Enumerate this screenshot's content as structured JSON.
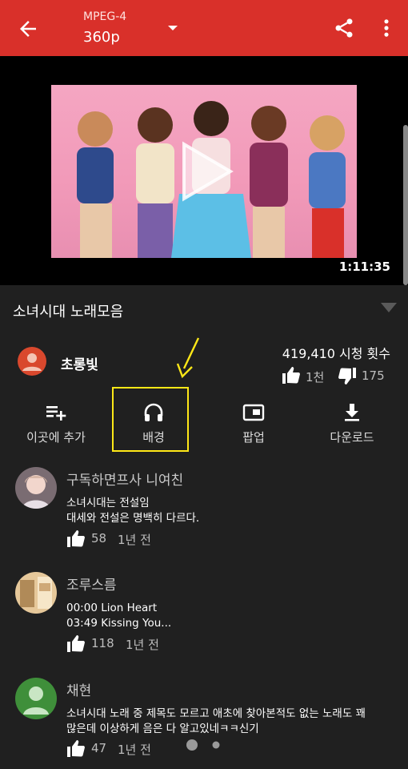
{
  "appbar": {
    "format": "MPEG-4",
    "resolution": "360p"
  },
  "player": {
    "duration": "1:11:35"
  },
  "video": {
    "title": "소녀시대 노래모음",
    "channel": "초롱빛",
    "views": "419,410 시청 횟수",
    "likes": "1천",
    "dislikes": "175"
  },
  "actions": [
    {
      "label": "이곳에 추가",
      "icon": "playlist-add-icon"
    },
    {
      "label": "배경",
      "icon": "headphones-icon"
    },
    {
      "label": "팝업",
      "icon": "popup-icon"
    },
    {
      "label": "다운로드",
      "icon": "download-icon"
    }
  ],
  "comments": [
    {
      "author": "구독하면프사 니여친",
      "lines": [
        "소녀시대는 전설임",
        "대세와 전설은 명백히 다르다."
      ],
      "likes": "58",
      "time": "1년 전"
    },
    {
      "author": "조루스름",
      "lines": [
        "00:00 Lion Heart",
        "03:49 Kissing You..."
      ],
      "likes": "118",
      "time": "1년 전"
    },
    {
      "author": "채현",
      "lines": [
        "소녀시대 노래 중 제목도 모르고 애초에 찾아본적도 없는 노래도 꽤",
        "많은데 이상하게 음은 다 알고있네ㅋㅋ신기"
      ],
      "likes": "47",
      "time": "1년 전"
    }
  ],
  "colors": {
    "appbar": "#d9302a",
    "background": "#202020",
    "highlight": "#ffe817"
  }
}
